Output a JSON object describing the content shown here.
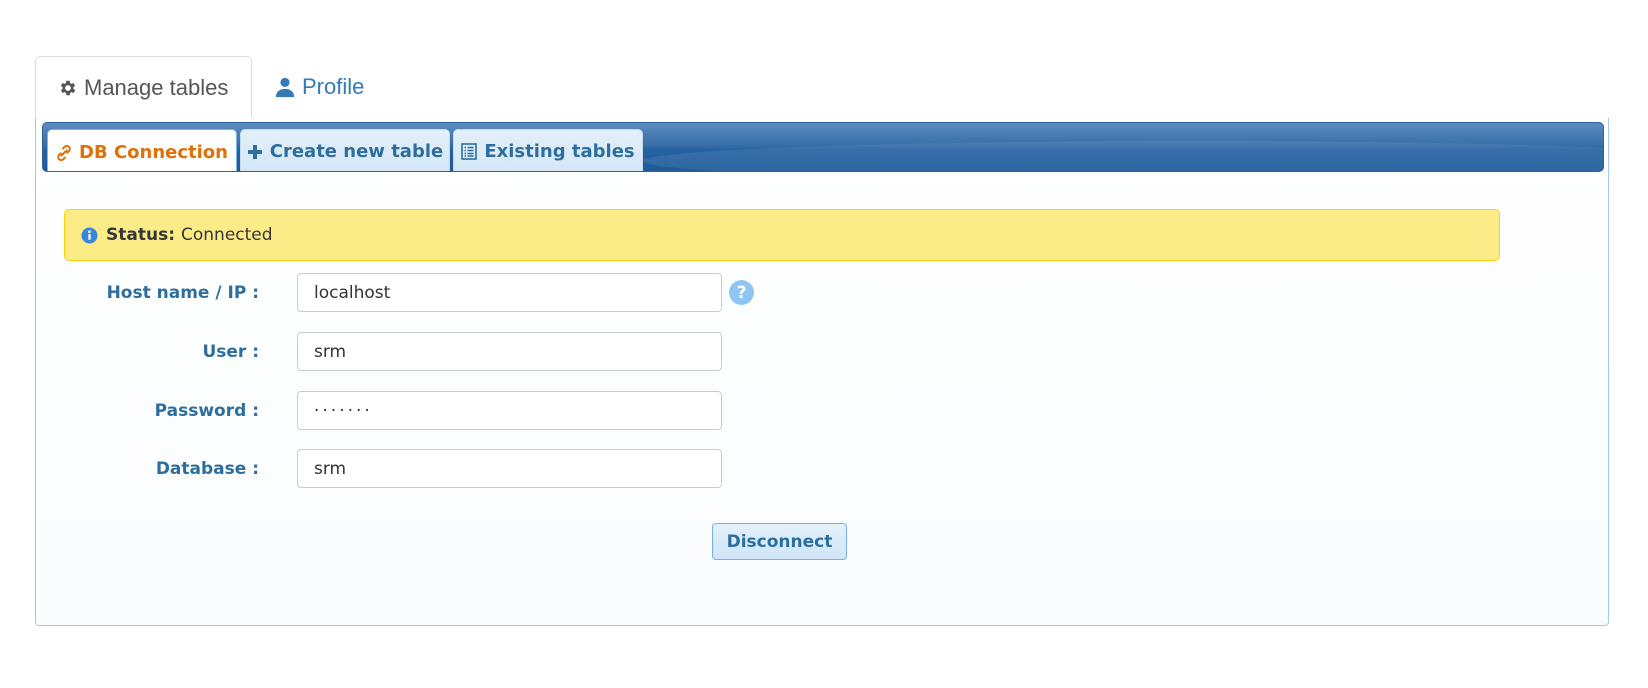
{
  "top_tabs": [
    {
      "label": "Manage tables",
      "icon": "gear-icon",
      "active": true
    },
    {
      "label": "Profile",
      "icon": "user-icon",
      "active": false
    }
  ],
  "sub_tabs": [
    {
      "label": "DB Connection",
      "icon": "link-icon",
      "active": true
    },
    {
      "label": "Create new table",
      "icon": "plus-icon",
      "active": false
    },
    {
      "label": "Existing tables",
      "icon": "list-icon",
      "active": false
    }
  ],
  "status": {
    "label": "Status:",
    "value": "Connected",
    "icon": "info-icon"
  },
  "form": {
    "host": {
      "label": "Host name / IP :",
      "value": "localhost",
      "help": "?"
    },
    "user": {
      "label": "User :",
      "value": "srm"
    },
    "password": {
      "label": "Password :",
      "value": "·······"
    },
    "database": {
      "label": "Database :",
      "value": "srm"
    }
  },
  "actions": {
    "disconnect_label": "Disconnect"
  },
  "colors": {
    "link": "#337ab7",
    "active_subtab_text": "#e17009",
    "label": "#2e6e9e",
    "status_bg": "#fbec88",
    "header_bar": "#2763a3"
  }
}
